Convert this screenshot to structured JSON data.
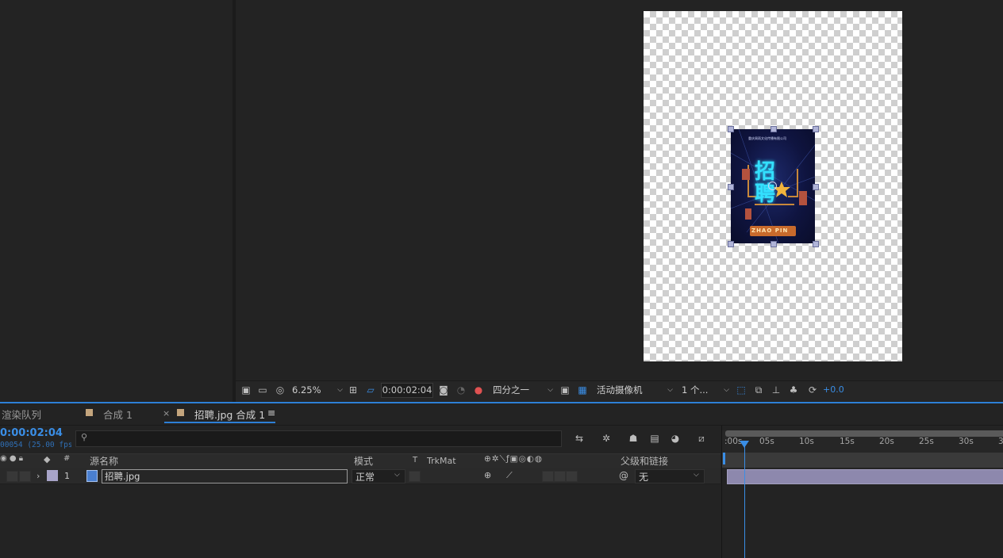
{
  "viewer": {
    "zoom": "6.25%",
    "timecode": "0:00:02:04",
    "resolution": "四分之一",
    "camera": "活动摄像机",
    "views": "1 个...",
    "exposure": "+0.0",
    "accent": "#2d7fd6"
  },
  "poster": {
    "top_text": "重庆周雨文化传播有限公司",
    "title_char": "招聘",
    "subtitle": "ZHAO PIN"
  },
  "tabs": {
    "render_queue": "渲染队列",
    "comp1": "合成 1",
    "close_glyph": "×",
    "active": "招聘.jpg 合成 1",
    "menu_glyph": "≡"
  },
  "timeline": {
    "current_time": "0:00:02:04",
    "fps_info": "00054 (25.00 fps)",
    "search_placeholder": "",
    "header": {
      "hash": "#",
      "source_name": "源名称",
      "mode": "模式",
      "t": "T",
      "trkmat": "TrkMat",
      "parent": "父级和链接"
    },
    "layer": {
      "number": "1",
      "name": "招聘.jpg",
      "mode": "正常",
      "parent": "无"
    },
    "ruler_labels": [
      ":00s",
      "05s",
      "10s",
      "15s",
      "20s",
      "25s",
      "30s",
      "3"
    ]
  }
}
